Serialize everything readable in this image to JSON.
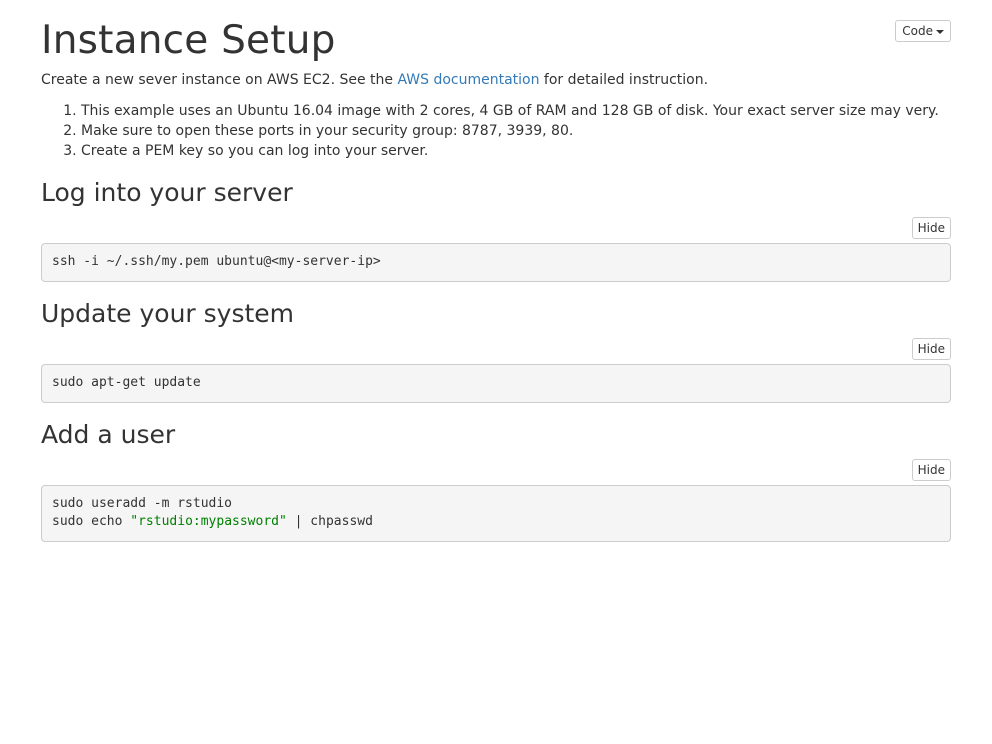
{
  "header": {
    "title": "Instance Setup",
    "code_button_label": "Code"
  },
  "intro": {
    "before": "Create a new sever instance on AWS EC2. See the ",
    "link_text": "AWS documentation",
    "after": " for detailed instruction."
  },
  "steps": [
    "This example uses an Ubuntu 16.04 image with 2 cores, 4 GB of RAM and 128 GB of disk. Your exact server size may very.",
    "Make sure to open these ports in your security group: 8787, 3939, 80.",
    "Create a PEM key so you can log into your server."
  ],
  "sections": [
    {
      "heading": "Log into your server",
      "hide_label": "Hide",
      "code_line1": "ssh -i ~/.ssh/my.pem ubuntu@<my-server-ip>"
    },
    {
      "heading": "Update your system",
      "hide_label": "Hide",
      "code_line1": "sudo apt-get update"
    },
    {
      "heading": "Add a user",
      "hide_label": "Hide",
      "code_line1": "sudo useradd -m rstudio",
      "code_line2_prefix": "sudo echo ",
      "code_line2_string": "\"rstudio:mypassword\"",
      "code_line2_suffix": " | chpasswd"
    }
  ],
  "colors": {
    "link": "#337ab7",
    "code_string": "#008000",
    "code_background": "#f5f5f5"
  }
}
